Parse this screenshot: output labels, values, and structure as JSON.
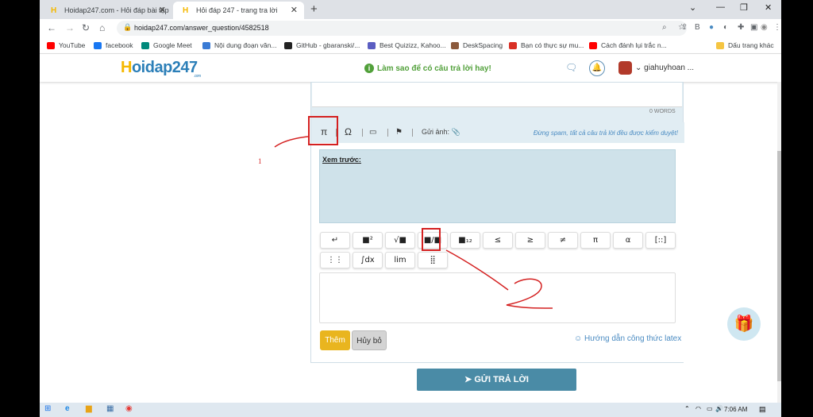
{
  "tabs": [
    {
      "title": "Hoidap247.com - Hỏi đáp bài tập",
      "active": false
    },
    {
      "title": "Hỏi đáp 247 - trang tra lời",
      "active": true
    }
  ],
  "url": "hoidap247.com/answer_question/4582518",
  "bookmarks": [
    {
      "label": "YouTube",
      "color": "#ff0000"
    },
    {
      "label": "facebook",
      "color": "#1877f2"
    },
    {
      "label": "Google Meet",
      "color": "#00897b"
    },
    {
      "label": "Nội dung đoạn văn...",
      "color": "#3a7bd5"
    },
    {
      "label": "GitHub - gbaranski/...",
      "color": "#222222"
    },
    {
      "label": "Best Quizizz, Kahoo...",
      "color": "#5b5ec2"
    },
    {
      "label": "DeskSpacing",
      "color": "#8b5a3c"
    },
    {
      "label": "Bạn có thực sự mu...",
      "color": "#d93025"
    },
    {
      "label": "Cách đánh lụi trắc n...",
      "color": "#ff0000"
    }
  ],
  "other_bookmarks": "Dấu trang khác",
  "site": {
    "logo": "oidap247",
    "logo_h": "H",
    "logo_com": ".com",
    "tip": "Làm sao để có câu trả lời hay!",
    "username": "giahuyhoan ..."
  },
  "editor": {
    "word_count": "0 WORDS",
    "gui_anh": "Gửi ảnh:",
    "spam_note": "Đừng spam, tất cả câu trả lời đều được kiểm duyệt!",
    "preview_label": "Xem trước:",
    "math_buttons_row1": [
      "↵",
      "■²",
      "√■",
      "■/■",
      "■₁₂",
      "≤",
      "≥",
      "≠",
      "π",
      "α",
      "[::]"
    ],
    "math_buttons_row2": [
      "⋮⋮",
      "∫dx",
      "lim",
      "⣿"
    ],
    "add_button": "Thêm",
    "cancel_button": "Hủy bỏ",
    "latex_guide": "Hướng dẫn công thức latex"
  },
  "submit": "GỬI TRẢ LỜI",
  "annotation_1": "1",
  "clock": "7:06 AM"
}
